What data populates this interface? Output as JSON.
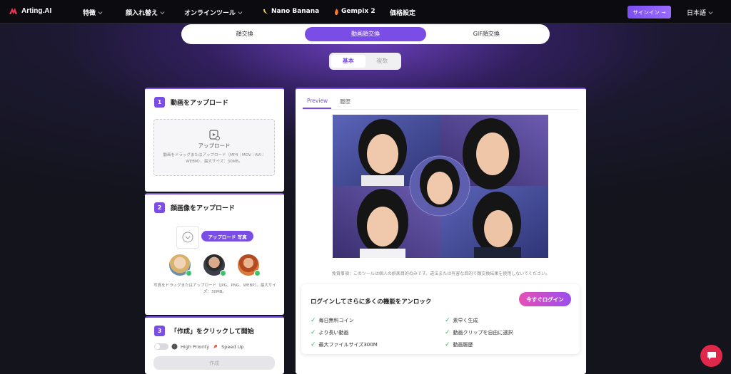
{
  "nav": {
    "logo": "Arting.AI",
    "items": [
      "特徴",
      "顔入れ替え",
      "オンラインツール",
      "Nano Banana",
      "Gempix 2",
      "価格設定"
    ],
    "signin": "サインイン →",
    "language": "日本語"
  },
  "tabs": [
    "顔交換",
    "動画顔交換",
    "GIF顔交換"
  ],
  "mode": [
    "基本",
    "複数"
  ],
  "step1": {
    "num": "1",
    "title": "動画をアップロード",
    "upload_label": "アップロード",
    "hint": "動画をドラッグまたはアップロード（MP4｜MOV｜AVI｜WEBM）。最大サイズ：30MB。"
  },
  "step2": {
    "num": "2",
    "title": "顔画像をアップロード",
    "upload_photo": "アップロード 写真",
    "hint": "写真をドラッグまたはアップロード（JPG、PNG、WEBP）。最大サイズ：30MB。"
  },
  "step3": {
    "num": "3",
    "title": "「作成」をクリックして開始",
    "high_priority": "High Priority",
    "speed_up": "Speed Up",
    "create": "作成"
  },
  "preview": {
    "tabs": [
      "Preview",
      "履歴"
    ],
    "disclaimer": "免責事項：このツールは個人の娯楽目的のみです。違法または有害な目的で顔交換結果を使用しないでください。"
  },
  "unlock": {
    "title": "ログインしてさらに多くの機能をアンロック",
    "login_now": "今すぐログイン",
    "features": [
      "毎日無料コイン",
      "素早く生成",
      "より長い動画",
      "動画クリップを自由に選択",
      "最大ファイルサイズ300M",
      "動画履歴"
    ]
  },
  "colors": {
    "accent": "#7a4ee6",
    "check": "#2fbf6a",
    "chat": "#e0284a"
  }
}
